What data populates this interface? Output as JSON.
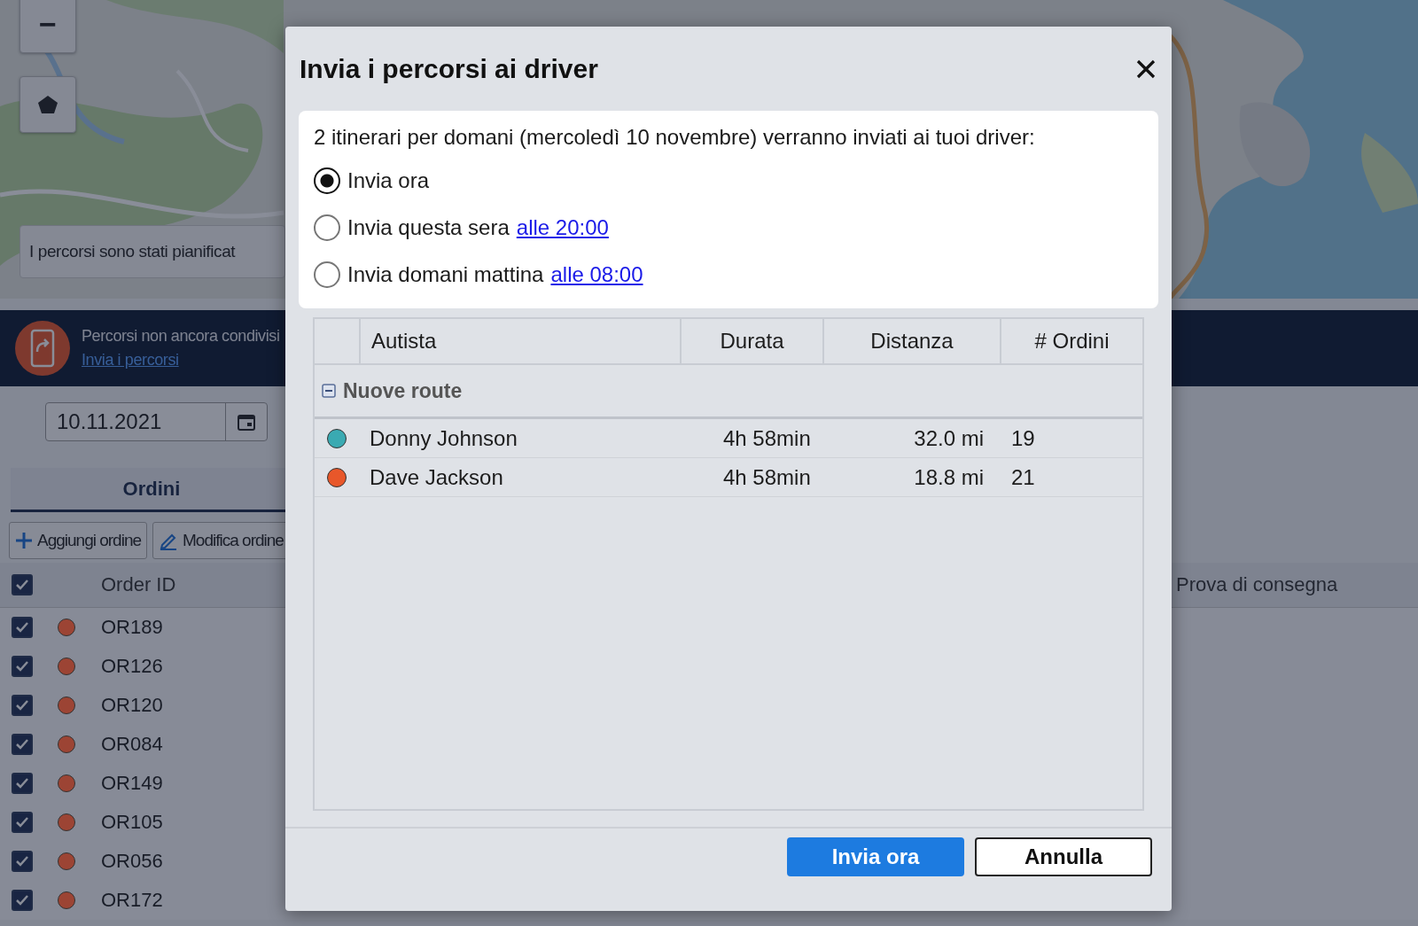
{
  "map": {
    "kind": "picture",
    "zoom_out": "−",
    "toast": "I percorsi sono stati pianificat"
  },
  "banner": {
    "text": "Percorsi non ancora condivisi",
    "link": "Invia i percorsi"
  },
  "date_field": {
    "value": "10.11.2021"
  },
  "tabs": [
    {
      "label": "Ordini",
      "selected": true
    }
  ],
  "toolbar": [
    {
      "kind": "add",
      "label": "Aggiungi ordine"
    },
    {
      "kind": "edit",
      "label": "Modifica ordine"
    }
  ],
  "orders": {
    "all_checked": true,
    "columns": [
      "Order ID",
      "Prova di consegna"
    ],
    "rows": [
      {
        "id": "OR189",
        "checked": true,
        "color": "#9c4434"
      },
      {
        "id": "OR126",
        "checked": true,
        "color": "#9c4434"
      },
      {
        "id": "OR120",
        "checked": true,
        "color": "#9c4434"
      },
      {
        "id": "OR084",
        "checked": true,
        "color": "#9c4434"
      },
      {
        "id": "OR149",
        "checked": true,
        "color": "#9c4434"
      },
      {
        "id": "OR105",
        "checked": true,
        "color": "#9c4434"
      },
      {
        "id": "OR056",
        "checked": true,
        "color": "#9c4434"
      },
      {
        "id": "OR172",
        "checked": true,
        "color": "#9c4434"
      }
    ]
  },
  "dialog": {
    "title": "Invia i percorsi ai driver",
    "intro": "2 itinerari per domani (mercoledì 10 novembre) verranno inviati ai tuoi driver:",
    "options": [
      {
        "label": "Invia ora",
        "selected": true
      },
      {
        "label": "Invia questa sera",
        "link": "alle 20:00",
        "selected": false
      },
      {
        "label": "Invia domani mattina",
        "link": "alle 08:00",
        "selected": false
      }
    ],
    "columns": [
      "Autista",
      "Durata",
      "Distanza",
      "# Ordini"
    ],
    "group": {
      "label": "Nuove route",
      "expanded": true
    },
    "rows": [
      {
        "name": "Donny Johnson",
        "color": "#3aaab2",
        "duration": "4h 58min",
        "distance": "32.0 mi",
        "orders": "19"
      },
      {
        "name": "Dave Jackson",
        "color": "#e8572a",
        "duration": "4h 58min",
        "distance": "18.8 mi",
        "orders": "21"
      }
    ],
    "buttons": [
      {
        "kind": "primary",
        "label": "Invia ora"
      },
      {
        "kind": "secondary",
        "label": "Annulla"
      }
    ]
  }
}
